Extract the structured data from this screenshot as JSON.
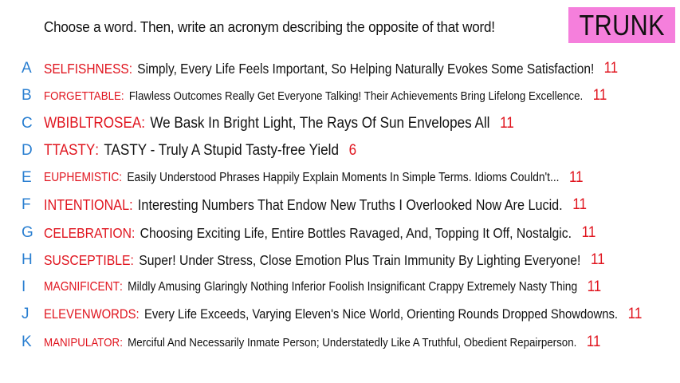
{
  "prompt": "Choose a word. Then, write an acronym describing the opposite of that word!",
  "badge": "TRUNK",
  "rows": [
    {
      "letter": "A",
      "word": "SELFISHNESS",
      "acronym": "Simply, Every Life Feels Important, So Helping Naturally Evokes Some Satisfaction!",
      "score": "11"
    },
    {
      "letter": "B",
      "word": "FORGETTABLE",
      "acronym": "Flawless Outcomes Really Get Everyone Talking! Their Achievements Bring Lifelong Excellence.",
      "score": "11"
    },
    {
      "letter": "C",
      "word": "WBIBLTROSEA",
      "acronym": "We Bask In Bright Light, The Rays Of Sun Envelopes All",
      "score": "11"
    },
    {
      "letter": "D",
      "word": "TTASTY",
      "acronym": "TASTY - Truly A Stupid Tasty-free Yield",
      "score": "6"
    },
    {
      "letter": "E",
      "word": "EUPHEMISTIC",
      "acronym": "Easily Understood Phrases Happily Explain Moments In Simple Terms. Idioms Couldn't...",
      "score": "11"
    },
    {
      "letter": "F",
      "word": "INTENTIONAL",
      "acronym": "Interesting Numbers That Endow New Truths I Overlooked Now Are Lucid.",
      "score": "11"
    },
    {
      "letter": "G",
      "word": "CELEBRATION",
      "acronym": "Choosing Exciting Life, Entire Bottles Ravaged, And, Topping It Off, Nostalgic.",
      "score": "11"
    },
    {
      "letter": "H",
      "word": "SUSCEPTIBLE",
      "acronym": "Super! Under Stress, Close Emotion Plus Train Immunity By Lighting Everyone!",
      "score": "11"
    },
    {
      "letter": "I",
      "word": "MAGNIFICENT",
      "acronym": "Mildly Amusing Glaringly Nothing Inferior Foolish Insignificant Crappy Extremely Nasty Thing",
      "score": "11"
    },
    {
      "letter": "J",
      "word": "ELEVENWORDS",
      "acronym": "Every Life Exceeds, Varying Eleven's Nice World, Orienting Rounds Dropped Showdowns.",
      "score": "11"
    },
    {
      "letter": "K",
      "word": "MANIPULATOR",
      "acronym": "Merciful And Necessarily Inmate Person; Understatedly Like A Truthful, Obedient Repairperson.",
      "score": "11"
    }
  ],
  "colors": {
    "letter": "#2a7fd1",
    "word": "#e0141e",
    "text": "#111111",
    "badge": "#f57fdc"
  }
}
